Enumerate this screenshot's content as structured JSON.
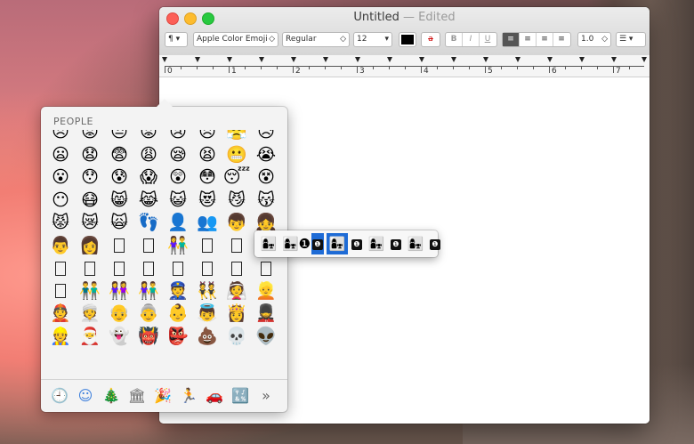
{
  "window": {
    "title": "Untitled",
    "title_separator": "—",
    "title_status": "Edited"
  },
  "toolbar": {
    "paragraph_btn": "¶ ▾",
    "font_family": "Apple Color Emoji",
    "font_style": "Regular",
    "font_size": "12",
    "bold": "B",
    "italic": "I",
    "underline": "U",
    "line_spacing": "1.0",
    "list_btn": "☰ ▾",
    "stepper_arrow": "◇",
    "dropdown_arrow": "▾",
    "text_color": "#000000",
    "highlight_color_label": "a"
  },
  "ruler": {
    "numbers": [
      "0",
      "1",
      "2",
      "3",
      "4",
      "5",
      "6",
      "7"
    ]
  },
  "emoji_picker": {
    "section_title": "PEOPLE",
    "rows": [
      [
        "😞",
        "😟",
        "😒",
        "😡",
        "😢",
        "😣",
        "😤",
        "😥"
      ],
      [
        "😦",
        "😧",
        "😨",
        "😩",
        "😪",
        "😫",
        "😬",
        "😭"
      ],
      [
        "😮",
        "😯",
        "😰",
        "😱",
        "😲",
        "😳",
        "😴",
        "😵"
      ],
      [
        "😶",
        "😷",
        "😸",
        "😹",
        "😺",
        "😻",
        "😼",
        "😽"
      ],
      [
        "😾",
        "😿",
        "🙀",
        "👣",
        "👤",
        "👥",
        "👦",
        "👧"
      ],
      [
        "👨",
        "👩",
        "□",
        "□",
        "👫",
        "□",
        "□",
        "□"
      ],
      [
        "□",
        "□",
        "□",
        "□",
        "□",
        "□",
        "□",
        "□"
      ],
      [
        "□",
        "👬",
        "👭",
        "👫",
        "👮",
        "👯",
        "👰",
        "👱"
      ],
      [
        "👲",
        "👳",
        "👴",
        "👵",
        "👶",
        "👼",
        "👸",
        "💂"
      ],
      [
        "👷",
        "🎅",
        "👻",
        "👹",
        "👺",
        "💩",
        "💀",
        "👽"
      ]
    ],
    "categories": [
      "recent-clock",
      "smiley",
      "tree",
      "bell",
      "party",
      "runner",
      "car",
      "symbols",
      "more"
    ],
    "category_glyphs": [
      "🕘",
      "☺",
      "🎄",
      "🏛",
      "🎉",
      "🏃",
      "🚗",
      "🔣",
      "»"
    ]
  },
  "variant_popup": {
    "items": [
      "👩‍👧",
      "👩‍👧‍❶",
      "❶",
      "👩‍👧",
      "❶",
      "👩‍👧",
      "❶",
      "👩‍👧",
      "❶"
    ]
  },
  "colors": {
    "selection": "#1e6bd6",
    "close": "#fc5f57",
    "minimize": "#fdbc2e",
    "zoom": "#28c940"
  }
}
